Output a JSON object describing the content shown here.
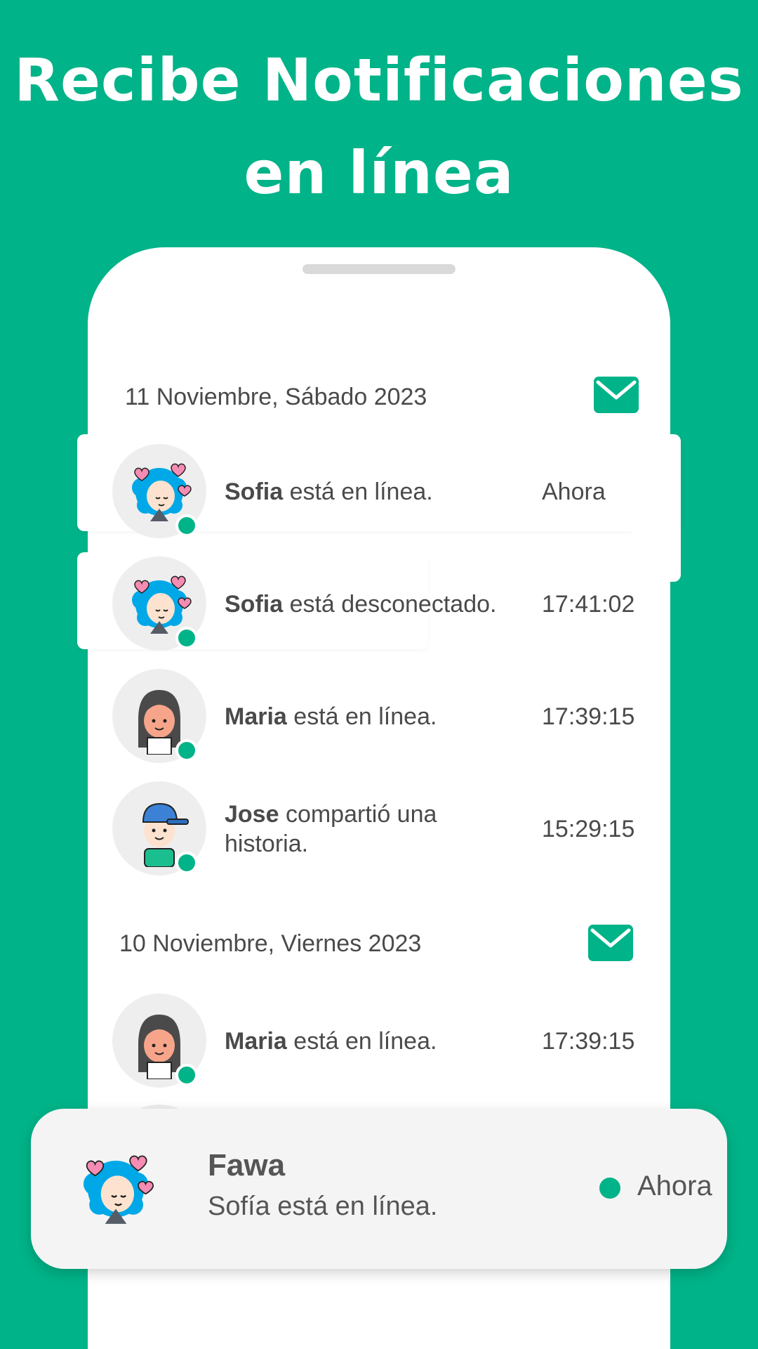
{
  "headline": {
    "line1": "Recibe Notificaciones",
    "line2": "en línea"
  },
  "colors": {
    "accent": "#00b388",
    "text": "#4a4a4a",
    "card": "#ffffff",
    "toast_bg": "#f4f4f4"
  },
  "sections": [
    {
      "date": "11 Noviembre, Sábado 2023",
      "icon": "mail-icon",
      "items": [
        {
          "name": "Sofia",
          "message": "está en línea.",
          "time": "Ahora",
          "avatar": "girl-hearts-avatar"
        },
        {
          "name": "Sofia",
          "message": "está desconectado.",
          "time": "17:41:02",
          "avatar": "girl-hearts-avatar"
        },
        {
          "name": "Maria",
          "message": "está en línea.",
          "time": "17:39:15",
          "avatar": "girl-dark-hair-avatar"
        },
        {
          "name": "Jose",
          "message": "compartió una historia.",
          "time": "15:29:15",
          "avatar": "boy-cap-avatar"
        }
      ]
    },
    {
      "date": "10 Noviembre, Viernes 2023",
      "icon": "mail-icon",
      "items": [
        {
          "name": "Maria",
          "message": "está en línea.",
          "time": "17:39:15",
          "avatar": "girl-dark-hair-avatar"
        }
      ]
    }
  ],
  "toast": {
    "app": "Fawa",
    "message": "Sofía está en línea.",
    "time": "Ahora",
    "avatar": "girl-hearts-avatar"
  }
}
